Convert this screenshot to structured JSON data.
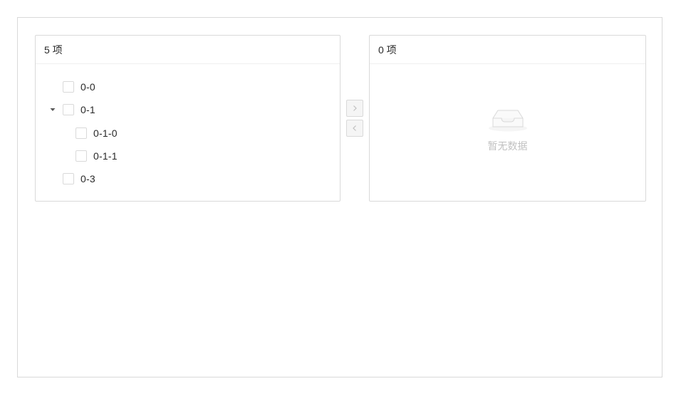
{
  "left_panel": {
    "header": "5 项",
    "tree": [
      {
        "title": "0-0"
      },
      {
        "title": "0-1",
        "expanded": true
      },
      {
        "title": "0-1-0"
      },
      {
        "title": "0-1-1"
      },
      {
        "title": "0-3"
      }
    ]
  },
  "right_panel": {
    "header": "0 项",
    "empty_text": "暂无数据"
  },
  "operations": {
    "move_right_icon": "right-arrow-icon",
    "move_left_icon": "left-arrow-icon",
    "disabled": true
  },
  "colors": {
    "border": "#d9d9d9",
    "header_divider": "#f0f0f0",
    "disabled_bg": "#f5f5f5",
    "muted_text": "#bfbfbf"
  }
}
